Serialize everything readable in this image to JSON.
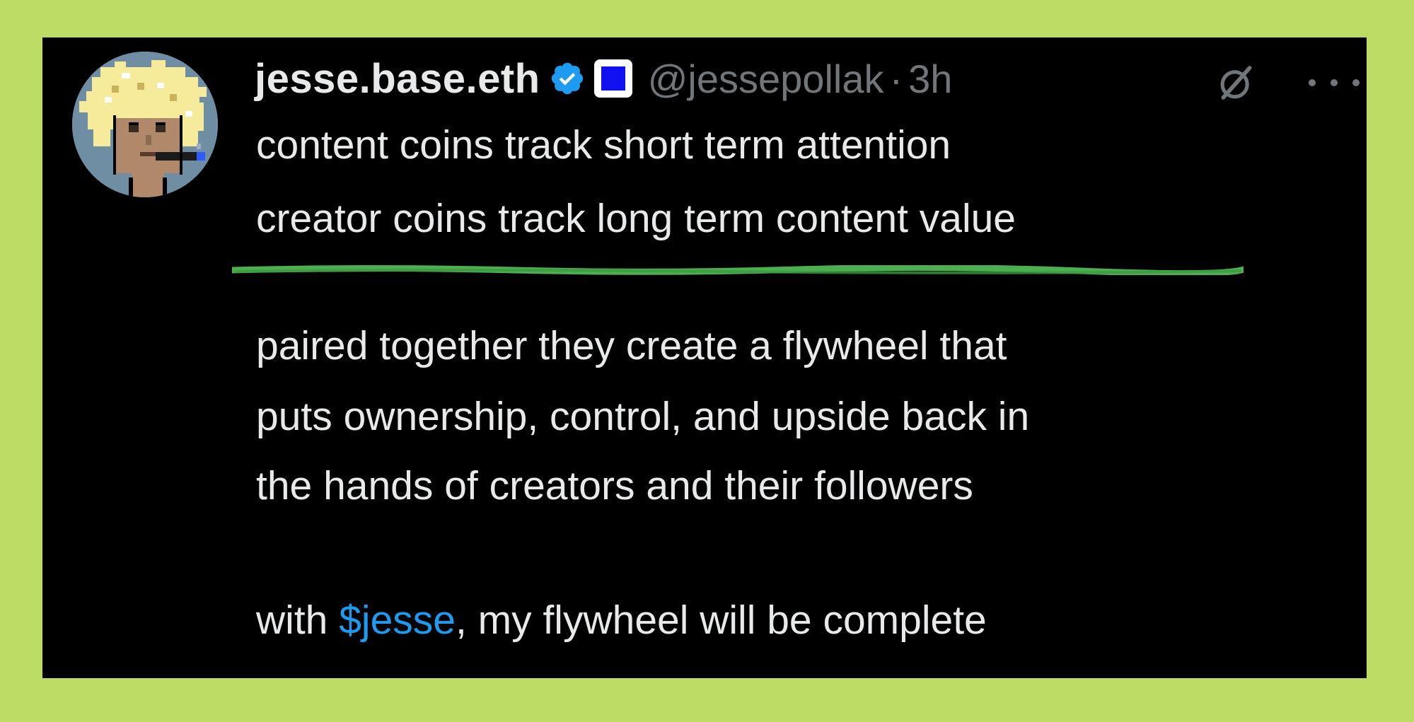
{
  "tweet": {
    "display_name": "jesse.base.eth",
    "handle": "@jessepollak",
    "separator": "·",
    "time": "3h",
    "lines": [
      "content coins track short term attention",
      "creator coins track long term content value",
      "paired together they create a flywheel that",
      "puts ownership, control, and upside back in",
      "the hands of creators and their followers"
    ],
    "last_line": {
      "prefix": "with ",
      "cashtag": "$jesse",
      "suffix": ", my flywheel will be complete"
    }
  },
  "icons": {
    "verified": "verified-badge-icon",
    "affiliate": "blue-square-badge-icon",
    "grok": "grok-icon",
    "more": "more-options-icon"
  },
  "colors": {
    "frame": "#bddc66",
    "background": "#000000",
    "text": "#e7e9ea",
    "muted": "#71767b",
    "link": "#1d9bf0",
    "verified": "#1d9bf0",
    "affiliate_square": "#1010f0",
    "highlight": "#4caf50"
  }
}
